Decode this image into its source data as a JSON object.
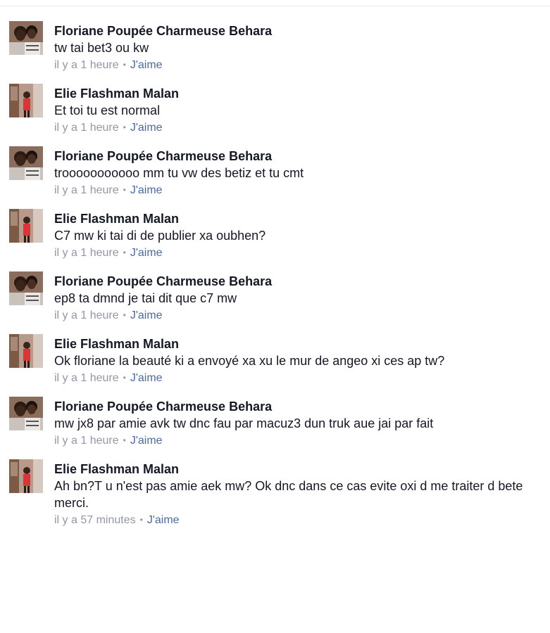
{
  "comments": [
    {
      "author": "Floriane Poupée Charmeuse Behara",
      "avatar": "avatar-photo-couple-icon",
      "text": "tw tai bet3 ou kw",
      "time": "il y a 1 heure",
      "separator": "•",
      "like_label": "J'aime"
    },
    {
      "author": "Elie Flashman Malan",
      "avatar": "avatar-photo-person-icon",
      "text": "Et toi tu est normal",
      "time": "il y a 1 heure",
      "separator": "•",
      "like_label": "J'aime"
    },
    {
      "author": "Floriane Poupée Charmeuse Behara",
      "avatar": "avatar-photo-couple-icon",
      "text": "trooooooooooo mm tu vw des betiz et tu cmt",
      "time": "il y a 1 heure",
      "separator": "•",
      "like_label": "J'aime"
    },
    {
      "author": "Elie Flashman Malan",
      "avatar": "avatar-photo-person-icon",
      "text": "C7 mw ki tai di de publier xa oubhen?",
      "time": "il y a 1 heure",
      "separator": "•",
      "like_label": "J'aime"
    },
    {
      "author": "Floriane Poupée Charmeuse Behara",
      "avatar": "avatar-photo-couple-icon",
      "text": "ep8 ta dmnd je tai dit que c7 mw",
      "time": "il y a 1 heure",
      "separator": "•",
      "like_label": "J'aime"
    },
    {
      "author": "Elie Flashman Malan",
      "avatar": "avatar-photo-person-icon",
      "text": "Ok floriane la beauté ki a envoyé xa xu le mur de angeo xi ces ap tw?",
      "time": "il y a 1 heure",
      "separator": "•",
      "like_label": "J'aime"
    },
    {
      "author": "Floriane Poupée Charmeuse Behara",
      "avatar": "avatar-photo-couple-icon",
      "text": "mw jx8 par amie avk tw dnc fau par macuz3 dun truk aue jai par fait",
      "time": "il y a 1 heure",
      "separator": "•",
      "like_label": "J'aime"
    },
    {
      "author": "Elie Flashman Malan",
      "avatar": "avatar-photo-person-icon",
      "text": "Ah bn?T u n'est pas amie aek mw? Ok dnc dans ce cas evite oxi d me traiter d bete merci.",
      "time": "il y a 57 minutes",
      "separator": "•",
      "like_label": "J'aime"
    }
  ]
}
